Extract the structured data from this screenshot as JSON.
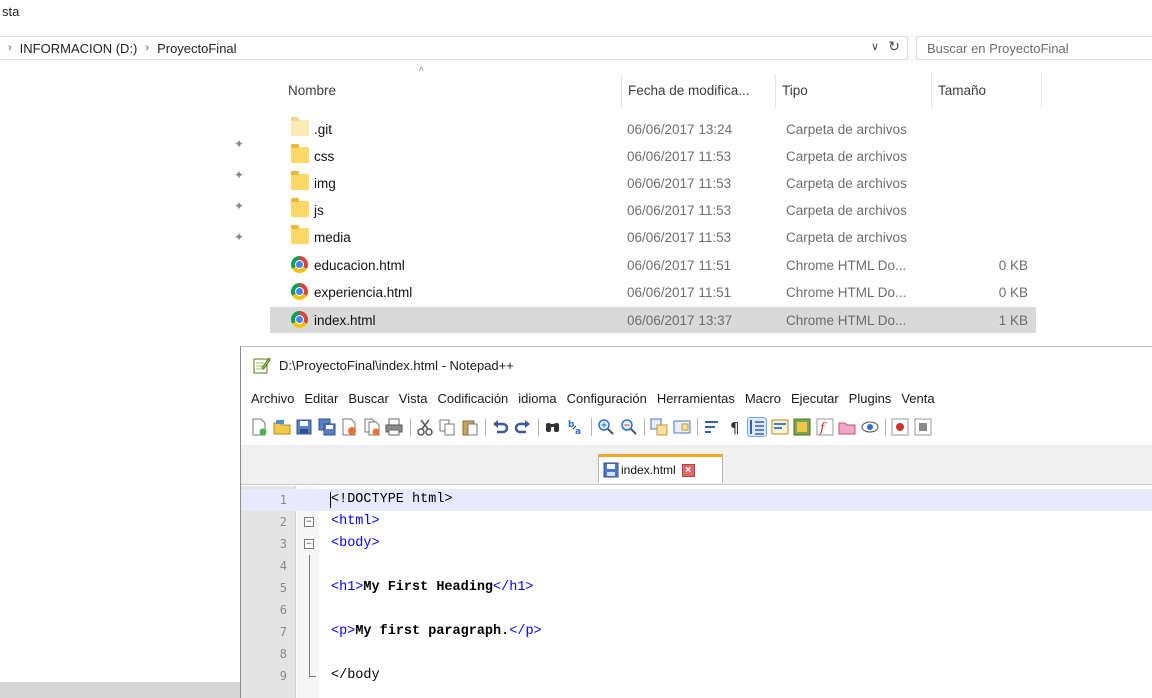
{
  "ribbon": {
    "label": "sta"
  },
  "address": {
    "crumbs": [
      "INFORMACION (D:)",
      "ProyectoFinal"
    ],
    "search_placeholder": "Buscar en ProyectoFinal"
  },
  "columns": {
    "name": "Nombre",
    "date": "Fecha de modifica...",
    "type": "Tipo",
    "size": "Tamaño"
  },
  "files": [
    {
      "name": ".git",
      "date": "06/06/2017 13:24",
      "type": "Carpeta de archivos",
      "size": "",
      "icon": "folder-icon"
    },
    {
      "name": "css",
      "date": "06/06/2017 11:53",
      "type": "Carpeta de archivos",
      "size": "",
      "icon": "folder-icon"
    },
    {
      "name": "img",
      "date": "06/06/2017 11:53",
      "type": "Carpeta de archivos",
      "size": "",
      "icon": "folder-icon"
    },
    {
      "name": "js",
      "date": "06/06/2017 11:53",
      "type": "Carpeta de archivos",
      "size": "",
      "icon": "folder-icon"
    },
    {
      "name": "media",
      "date": "06/06/2017 11:53",
      "type": "Carpeta de archivos",
      "size": "",
      "icon": "folder-icon"
    },
    {
      "name": "educacion.html",
      "date": "06/06/2017 11:51",
      "type": "Chrome HTML Do...",
      "size": "0 KB",
      "icon": "chrome-icon"
    },
    {
      "name": "experiencia.html",
      "date": "06/06/2017 11:51",
      "type": "Chrome HTML Do...",
      "size": "0 KB",
      "icon": "chrome-icon"
    },
    {
      "name": "index.html",
      "date": "06/06/2017 13:37",
      "type": "Chrome HTML Do...",
      "size": "1 KB",
      "icon": "chrome-icon"
    }
  ],
  "notepad": {
    "title": "D:\\ProyectoFinal\\index.html - Notepad++",
    "menu": [
      "Archivo",
      "Editar",
      "Buscar",
      "Vista",
      "Codificación",
      "idioma",
      "Configuración",
      "Herramientas",
      "Macro",
      "Ejecutar",
      "Plugins",
      "Venta"
    ],
    "tab_label": "index.html",
    "lines": [
      {
        "num": "1",
        "tokens": [
          [
            "doc",
            "<!DOCTYPE html>"
          ]
        ]
      },
      {
        "num": "2",
        "tokens": [
          [
            "tag",
            "<html>"
          ]
        ]
      },
      {
        "num": "3",
        "tokens": [
          [
            "tag",
            "<body>"
          ]
        ]
      },
      {
        "num": "4",
        "tokens": []
      },
      {
        "num": "5",
        "tokens": [
          [
            "tag",
            "<h1>"
          ],
          [
            "txt",
            "My First Heading"
          ],
          [
            "tag",
            "</h1>"
          ]
        ]
      },
      {
        "num": "6",
        "tokens": []
      },
      {
        "num": "7",
        "tokens": [
          [
            "tag",
            "<p>"
          ],
          [
            "txt",
            "My first paragraph."
          ],
          [
            "tag",
            "</p>"
          ]
        ]
      },
      {
        "num": "8",
        "tokens": []
      },
      {
        "num": "9",
        "tokens": [
          [
            "doc",
            "</body"
          ]
        ]
      }
    ]
  },
  "colors": {
    "selection": "#d9d9d9",
    "tag": "#0000ff",
    "current_line": "#e8e8ff",
    "tab_accent": "#f5a623"
  }
}
